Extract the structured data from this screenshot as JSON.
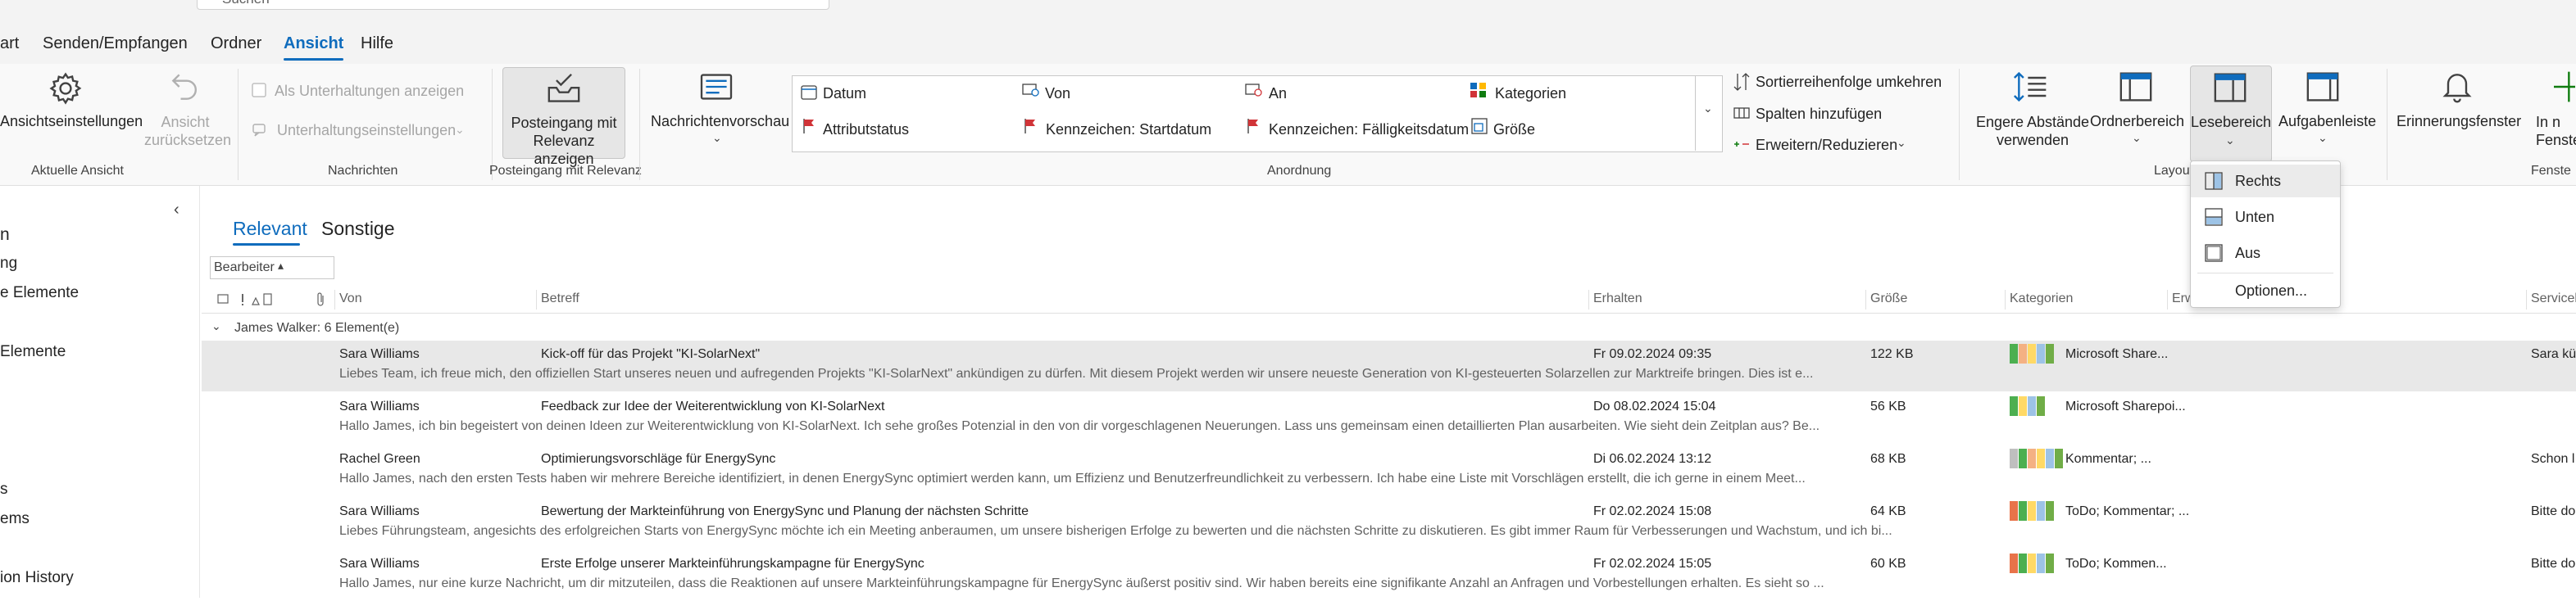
{
  "search": {
    "placeholder": "Suchen"
  },
  "menu_tabs": [
    {
      "label": "art"
    },
    {
      "label": "Senden/Empfangen"
    },
    {
      "label": "Ordner"
    },
    {
      "label": "Ansicht"
    },
    {
      "label": "Hilfe"
    }
  ],
  "ribbon": {
    "aktuelle_ansicht": {
      "settings": "Ansichtseinstellungen",
      "reset": "Ansicht\nzurücksetzen",
      "group": "Aktuelle Ansicht"
    },
    "nachrichten": {
      "conversations": "Als Unterhaltungen anzeigen",
      "conv_settings": "Unterhaltungseinstellungen",
      "group": "Nachrichten"
    },
    "relevanz": {
      "button": "Posteingang mit\nRelevanz anzeigen",
      "group": "Posteingang mit Relevanz"
    },
    "vorschau": {
      "button": "Nachrichtenvorschau"
    },
    "anordnung": {
      "items": [
        "Datum",
        "Von",
        "An",
        "Kategorien",
        "Attributstatus",
        "Kennzeichen: Startdatum",
        "Kennzeichen: Fälligkeitsdatum",
        "Größe"
      ],
      "reverse": "Sortierreihenfolge umkehren",
      "add_columns": "Spalten hinzufügen",
      "expand": "Erweitern/Reduzieren",
      "group": "Anordnung"
    },
    "layout": {
      "tighter": "Engere Abstände\nverwenden",
      "folder_pane": "Ordnerbereich",
      "reading_pane": "Lesebereich",
      "todo": "Aufgabenleiste",
      "group": "Layout"
    },
    "fenster": {
      "reminder": "Erinnerungsfenster",
      "new_window": "In n\nFenste",
      "group": "Fenste"
    }
  },
  "dropdown": {
    "items": [
      {
        "label": "Rechts",
        "icon": "reading-pane-right-icon"
      },
      {
        "label": "Unten",
        "icon": "reading-pane-bottom-icon"
      },
      {
        "label": "Aus",
        "icon": "reading-pane-off-icon"
      }
    ],
    "options": "Optionen..."
  },
  "leftnav": {
    "items": [
      "n",
      "ng",
      "e Elemente",
      "Elemente",
      "s",
      "ems",
      "ion History"
    ]
  },
  "list": {
    "tabs": [
      "Relevant",
      "Sonstige"
    ],
    "filter": "Bearbeiter",
    "columns": [
      "Von",
      "Betreff",
      "Erhalten",
      "Größe",
      "Kategorien",
      "Erw",
      "Servicel"
    ],
    "group_header": "James Walker: 6 Element(e)",
    "messages": [
      {
        "from": "Sara Williams",
        "subject": "Kick-off für das Projekt \"KI-SolarNext\"",
        "received": "Fr 09.02.2024 09:35",
        "size": "122 KB",
        "categories": "Microsoft Share...",
        "extra": "Sara kü",
        "preview": "Liebes Team,  ich freue mich, den offiziellen Start unseres neuen und aufregenden Projekts \"KI-SolarNext\" ankündigen zu dürfen. Mit diesem Projekt werden wir unsere neueste Generation von KI-gesteuerten Solarzellen zur Marktreife bringen. Dies ist e...",
        "colors": [
          "#4caf50",
          "#f4b183",
          "#ffd966",
          "#9dc3e6",
          "#70ad47"
        ]
      },
      {
        "from": "Sara Williams",
        "subject": "Feedback zur Idee der Weiterentwicklung von KI-SolarNext",
        "received": "Do 08.02.2024 15:04",
        "size": "56 KB",
        "categories": "Microsoft Sharepoi...",
        "extra": "",
        "preview": "Hallo James,  ich bin begeistert von deinen Ideen zur Weiterentwicklung von KI-SolarNext. Ich sehe großes Potenzial in den von dir vorgeschlagenen Neuerungen. Lass uns gemeinsam einen detaillierten Plan ausarbeiten.  Wie sieht dein Zeitplan aus?  Be...",
        "colors": [
          "#4caf50",
          "#ffd966",
          "#9dc3e6",
          "#70ad47"
        ]
      },
      {
        "from": "Rachel Green",
        "subject": "Optimierungsvorschläge für EnergySync",
        "received": "Di 06.02.2024 13:12",
        "size": "68 KB",
        "categories": "Kommentar; ...",
        "extra": "Schon l",
        "preview": "Hallo James,  nach den ersten Tests haben wir mehrere Bereiche identifiziert, in denen EnergySync optimiert werden kann, um Effizienz und Benutzerfreundlichkeit zu verbessern. Ich habe eine Liste mit Vorschlägen erstellt, die ich gerne in einem Meet...",
        "colors": [
          "#bfbfbf",
          "#4caf50",
          "#f4b183",
          "#ffd966",
          "#9dc3e6",
          "#70ad47"
        ]
      },
      {
        "from": "Sara Williams",
        "subject": "Bewertung der Markteinführung von EnergySync und Planung der nächsten Schritte",
        "received": "Fr 02.02.2024 15:08",
        "size": "64 KB",
        "categories": "ToDo; Kommentar; ...",
        "extra": "Bitte do",
        "preview": "Liebes Führungsteam,  angesichts des erfolgreichen Starts von EnergySync möchte ich ein Meeting anberaumen, um unsere bisherigen Erfolge zu bewerten und die nächsten Schritte zu diskutieren. Es gibt immer Raum für Verbesserungen und Wachstum, und ich bi...",
        "colors": [
          "#e8734a",
          "#4caf50",
          "#ffd966",
          "#9dc3e6",
          "#70ad47"
        ]
      },
      {
        "from": "Sara Williams",
        "subject": "Erste Erfolge unserer Markteinführungskampagne für EnergySync",
        "received": "Fr 02.02.2024 15:05",
        "size": "60 KB",
        "categories": "ToDo; Kommen...",
        "extra": "Bitte do",
        "preview": "Hallo James,  nur eine kurze Nachricht, um dir mitzuteilen, dass die Reaktionen auf unsere Markteinführungskampagne für EnergySync äußerst positiv sind. Wir haben bereits eine signifikante Anzahl an Anfragen und Vorbestellungen erhalten.  Es sieht so ...",
        "colors": [
          "#e8734a",
          "#4caf50",
          "#ffd966",
          "#9dc3e6",
          "#70ad47"
        ]
      }
    ]
  },
  "colors": {
    "accent": "#0f6cbd",
    "selected_row": "#e8e8e8",
    "flag_red": "#d13438"
  }
}
